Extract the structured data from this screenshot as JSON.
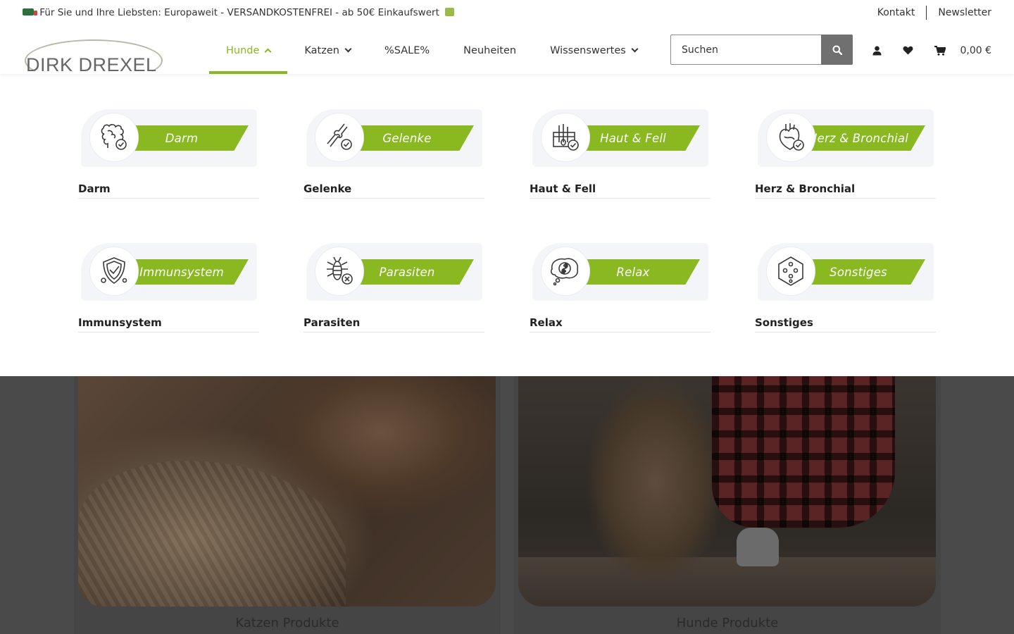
{
  "topbar": {
    "promo": "Für Sie und Ihre Liebsten: Europaweit - VERSANDKOSTENFREI - ab 50€ Einkaufswert",
    "links": [
      "Kontakt",
      "Newsletter"
    ]
  },
  "logo": {
    "text": "DIRK DREXEL"
  },
  "nav": {
    "items": [
      {
        "label": "Hunde",
        "active": true,
        "dropdown": true
      },
      {
        "label": "Katzen",
        "active": false,
        "dropdown": true
      },
      {
        "label": "%SALE%",
        "active": false,
        "dropdown": false
      },
      {
        "label": "Neuheiten",
        "active": false,
        "dropdown": false
      },
      {
        "label": "Wissenswertes",
        "active": false,
        "dropdown": true
      }
    ],
    "accent_color": "#8ab821"
  },
  "search": {
    "placeholder": "Suchen"
  },
  "cart": {
    "amount": "0,00 €"
  },
  "mega_menu": {
    "categories": [
      {
        "banner": "Darm",
        "label": "Darm",
        "icon": "intestine-icon"
      },
      {
        "banner": "Gelenke",
        "label": "Gelenke",
        "icon": "joint-icon"
      },
      {
        "banner": "Haut & Fell",
        "label": "Haut & Fell",
        "icon": "skin-hair-icon"
      },
      {
        "banner": "Herz & Bronchial",
        "label": "Herz & Bronchial",
        "icon": "heart-icon"
      },
      {
        "banner": "Immunsystem",
        "label": "Immunsystem",
        "icon": "shield-icon"
      },
      {
        "banner": "Parasiten",
        "label": "Parasiten",
        "icon": "parasite-icon"
      },
      {
        "banner": "Relax",
        "label": "Relax",
        "icon": "yin-yang-icon"
      },
      {
        "banner": "Sonstiges",
        "label": "Sonstiges",
        "icon": "misc-hexagon-icon"
      }
    ]
  },
  "page": {
    "cards": [
      {
        "caption": "Katzen Produkte"
      },
      {
        "caption": "Hunde Produkte"
      }
    ]
  }
}
